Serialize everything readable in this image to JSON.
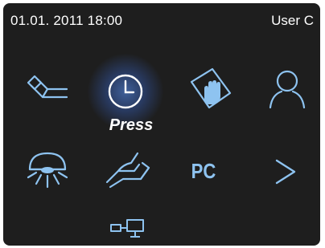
{
  "status_bar": {
    "datetime": "01.01. 2011 18:00",
    "user": "User C"
  },
  "row1": [
    {
      "icon": "handpiece-icon"
    },
    {
      "icon": "clock-icon",
      "selected": true,
      "caption": "Press"
    },
    {
      "icon": "hand-touch-icon"
    },
    {
      "icon": "user-profile-icon"
    }
  ],
  "row2": [
    {
      "icon": "dental-light-icon"
    },
    {
      "icon": "foot-control-icon"
    },
    {
      "icon": "pc-icon",
      "label": "PC"
    },
    {
      "icon": "chevron-right-icon"
    }
  ],
  "row3": [
    {
      "icon": "network-connection-icon"
    }
  ],
  "colors": {
    "background": "#1e1e1e",
    "icon": "#8ec3f0",
    "text": "#ffffff",
    "selected_glow": "#5a96ff"
  }
}
